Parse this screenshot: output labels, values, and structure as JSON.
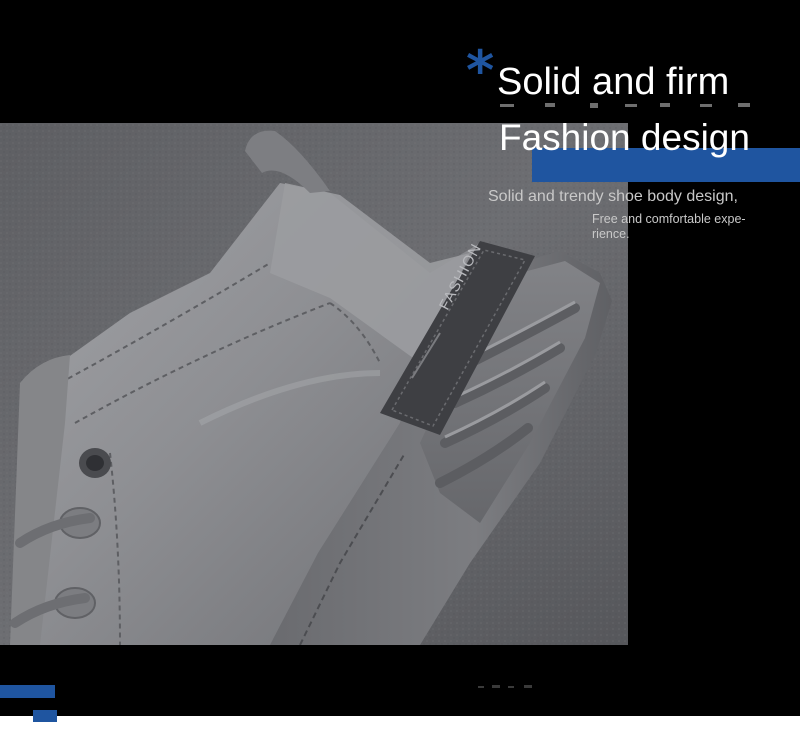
{
  "headline": {
    "line1": "Solid and firm",
    "line2": "Fashion design"
  },
  "description": {
    "line1": "Solid and trendy shoe body design,",
    "line2": "Free and comfortable expe-",
    "line3": "rience."
  },
  "shoe": {
    "heel_label": "FASHION"
  },
  "icons": {
    "asterisk": "asterisk-icon"
  },
  "colors": {
    "background": "#000000",
    "accent_blue": "#1f55a0",
    "text_white": "#ffffff",
    "text_gray": "#c9c9c9",
    "shoe_gray": "#8c8d91"
  }
}
